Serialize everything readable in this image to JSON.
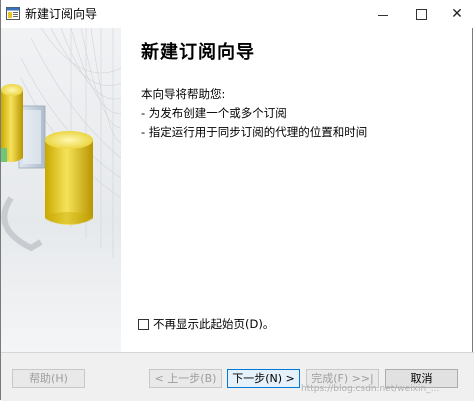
{
  "window": {
    "title": "新建订阅向导",
    "minimize_label": "—",
    "close_label": "✕"
  },
  "page": {
    "heading": "新建订阅向导",
    "intro": "本向导将帮助您:",
    "bullets": [
      "- 为发布创建一个或多个订阅",
      "- 指定运行用于同步订阅的代理的位置和时间"
    ]
  },
  "checkbox": {
    "label": "不再显示此起始页(D)。",
    "checked": false
  },
  "buttons": {
    "help": "帮助(H)",
    "prev": "< 上一步(B)",
    "next": "下一步(N) >",
    "finish": "完成(F) >>|",
    "cancel": "取消"
  },
  "watermark": "https://blog.csdn.net/weixin_..."
}
